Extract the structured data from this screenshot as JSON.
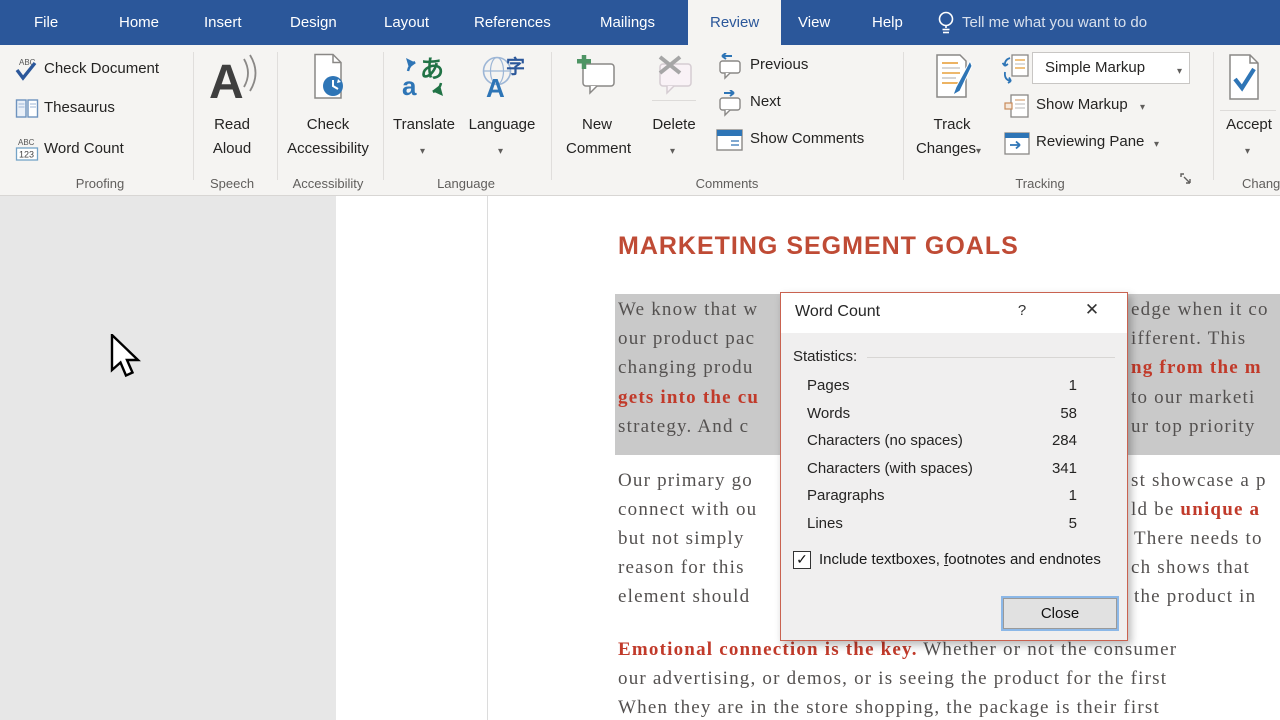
{
  "tabbar": {
    "tabs": [
      {
        "label": "File"
      },
      {
        "label": "Home"
      },
      {
        "label": "Insert"
      },
      {
        "label": "Design"
      },
      {
        "label": "Layout"
      },
      {
        "label": "References"
      },
      {
        "label": "Mailings"
      },
      {
        "label": "Review",
        "selected": true
      },
      {
        "label": "View"
      },
      {
        "label": "Help"
      }
    ],
    "tell_me": "Tell me what you want to do"
  },
  "ribbon": {
    "proofing": {
      "group": "Proofing",
      "check_document": "Check Document",
      "thesaurus": "Thesaurus",
      "word_count": "Word Count"
    },
    "speech": {
      "group": "Speech",
      "read": "Read",
      "aloud": "Aloud"
    },
    "accessibility": {
      "group": "Accessibility",
      "line1": "Check",
      "line2": "Accessibility"
    },
    "language": {
      "group": "Language",
      "translate": "Translate",
      "language": "Language"
    },
    "comments": {
      "group": "Comments",
      "new_line1": "New",
      "new_line2": "Comment",
      "delete": "Delete",
      "previous": "Previous",
      "next": "Next",
      "show_comments": "Show Comments"
    },
    "tracking": {
      "group": "Tracking",
      "track_line1": "Track",
      "track_line2": "Changes",
      "simple_markup": "Simple Markup",
      "show_markup": "Show Markup",
      "reviewing_pane": "Reviewing Pane"
    },
    "changes": {
      "group": "Changes",
      "accept": "Accept"
    }
  },
  "document": {
    "heading": "MARKETING SEGMENT GOALS",
    "para1": {
      "left": [
        "We know that w",
        "our product pac",
        "changing produ",
        "gets into the cu",
        "strategy. And c"
      ],
      "right": [
        "edge when it co",
        "ifferent. This",
        "ng from the m",
        "to our marketi",
        "ur top priority"
      ]
    },
    "para2": {
      "left": [
        "Our primary go",
        "connect with ou",
        "but not simply",
        "reason for this",
        "element should"
      ],
      "right_1": "st showcase a p",
      "right_2": [
        {
          "text": "ld be "
        },
        {
          "text": "unique a",
          "style": "red"
        }
      ],
      "right_3": "There needs to",
      "right_4": "ch shows that",
      "right_5": "the product in"
    },
    "para3": {
      "line1": [
        {
          "text": "Emotional connection is the key.",
          "style": "red"
        },
        {
          "text": " Whether or not the consumer"
        }
      ],
      "line2": "our advertising, or demos, or is seeing the product for the first",
      "line3": "When they are in the store shopping, the package is their first"
    }
  },
  "dialog": {
    "title": "Word Count",
    "help_button": "?",
    "close_icon": "✕",
    "statistics_label": "Statistics:",
    "rows": [
      {
        "label": "Pages",
        "value": "1"
      },
      {
        "label": "Words",
        "value": "58"
      },
      {
        "label": "Characters (no spaces)",
        "value": "284"
      },
      {
        "label": "Characters (with spaces)",
        "value": "341"
      },
      {
        "label": "Paragraphs",
        "value": "1"
      },
      {
        "label": "Lines",
        "value": "5"
      }
    ],
    "checkbox": {
      "checked": true,
      "glyph": "✓",
      "label_segments": [
        {
          "text": "Include textboxes, "
        },
        {
          "text": "f",
          "style": "underline"
        },
        {
          "text": "ootnotes and endnotes"
        }
      ]
    },
    "close_button": "Close"
  },
  "colors": {
    "tab_bar": "#2B579A",
    "ribbon_bg": "#F5F4F2",
    "heading": "#BF4B35",
    "red_text": "#C13A2A",
    "selection_highlight": "#C9C9C9",
    "dialog_border": "#C96250",
    "accent_blue": "#2B579A",
    "green_accent": "#217346"
  }
}
